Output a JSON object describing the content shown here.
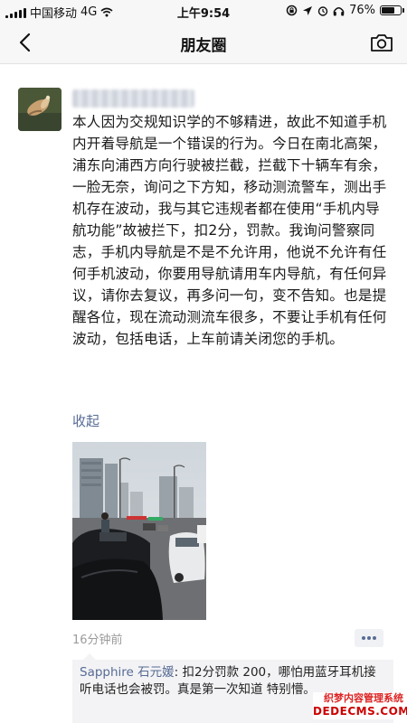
{
  "status_bar": {
    "carrier": "中国移动",
    "network": "4G",
    "time": "上午9:54",
    "battery": "76%",
    "battery_level": 0.76
  },
  "nav": {
    "title": "朋友圈",
    "back_icon": "chevron-left-icon",
    "camera_icon": "camera-icon"
  },
  "post": {
    "text": "本人因为交规知识学的不够精进，故此不知道手机内开着导航是一个错误的行为。今日在南北高架，浦东向浦西方向行驶被拦截，拦截下十辆车有余，一脸无奈，询问之下方知，移动测流警车，测出手机存在波动，我与其它违规者都在使用“手机内导航功能”故被拦下，扣2分，罚款。我询问警察同志，手机内导航是不是不允许用，他说不允许有任何手机波动，你要用导航请用车内导航，有任何异议，请你去复议，再多问一句，变不告知。也是提醒各位，现在流动测流车很多，不要让手机有任何波动，包括电话，上车前请关闭您的手机。",
    "collapse_label": "收起",
    "timestamp": "16分钟前",
    "link_color": "#576b95"
  },
  "comments": [
    {
      "author": "Sapphire 石元媛",
      "text": ": 扣2分罚款 200，哪怕用蓝牙耳机接听电话也会被罚。真是第一次知道 特别懵。"
    }
  ],
  "watermark": {
    "line1": "织梦内容管理系统",
    "line2": "DEDECMS.COM"
  }
}
